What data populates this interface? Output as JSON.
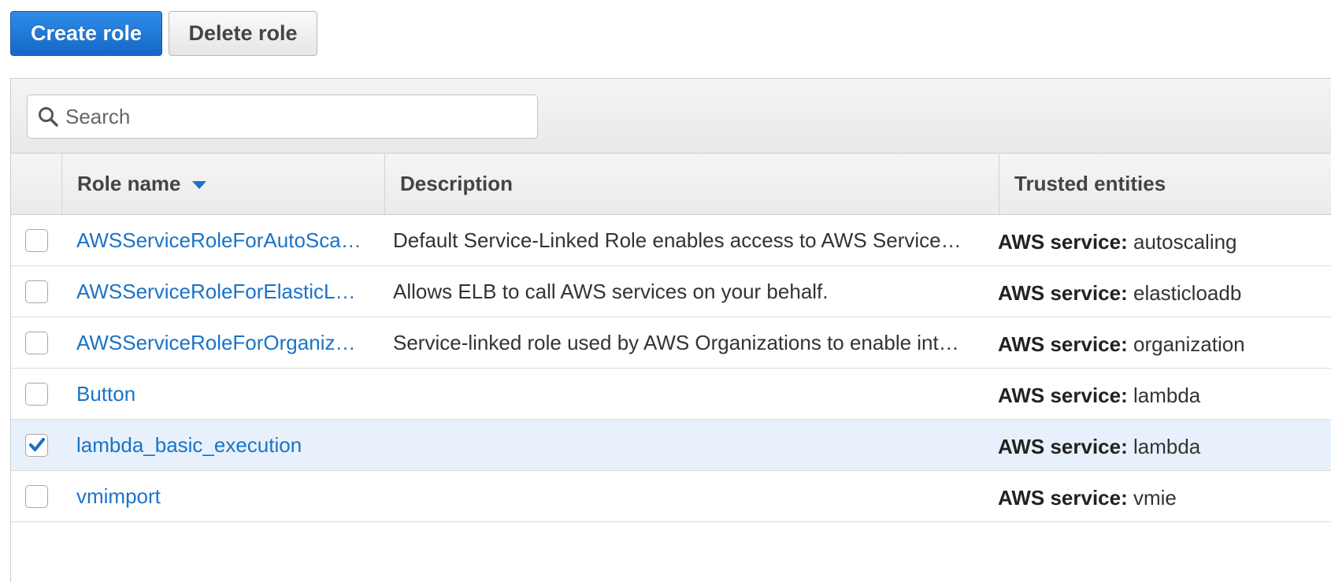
{
  "toolbar": {
    "create_label": "Create role",
    "delete_label": "Delete role"
  },
  "search": {
    "placeholder": "Search",
    "value": ""
  },
  "table": {
    "headers": {
      "role_name": "Role name",
      "description": "Description",
      "trusted_entities": "Trusted entities"
    },
    "sort": {
      "column": "role_name",
      "direction": "descending-indicator"
    },
    "rows": [
      {
        "role_name": "AWSServiceRoleForAutoSca…",
        "description": "Default Service-Linked Role enables access to AWS Service…",
        "trusted_label": "AWS service:",
        "trusted_value": "autoscaling",
        "checked": false
      },
      {
        "role_name": "AWSServiceRoleForElasticL…",
        "description": "Allows ELB to call AWS services on your behalf.",
        "trusted_label": "AWS service:",
        "trusted_value": "elasticloadb",
        "checked": false
      },
      {
        "role_name": "AWSServiceRoleForOrganiz…",
        "description": "Service-linked role used by AWS Organizations to enable int…",
        "trusted_label": "AWS service:",
        "trusted_value": "organization",
        "checked": false
      },
      {
        "role_name": "Button",
        "description": "",
        "trusted_label": "AWS service:",
        "trusted_value": "lambda",
        "checked": false
      },
      {
        "role_name": "lambda_basic_execution",
        "description": "",
        "trusted_label": "AWS service:",
        "trusted_value": "lambda",
        "checked": true
      },
      {
        "role_name": "vmimport",
        "description": "",
        "trusted_label": "AWS service:",
        "trusted_value": "vmie",
        "checked": false
      }
    ]
  },
  "colors": {
    "primary_button": "#1f78d6",
    "link": "#1a73c8",
    "selected_row": "#e8f1fb",
    "checkbox_check": "#1a6fc4"
  },
  "icons": {
    "search": "search-icon",
    "sort": "sort-down-icon",
    "check": "checkmark-icon"
  }
}
